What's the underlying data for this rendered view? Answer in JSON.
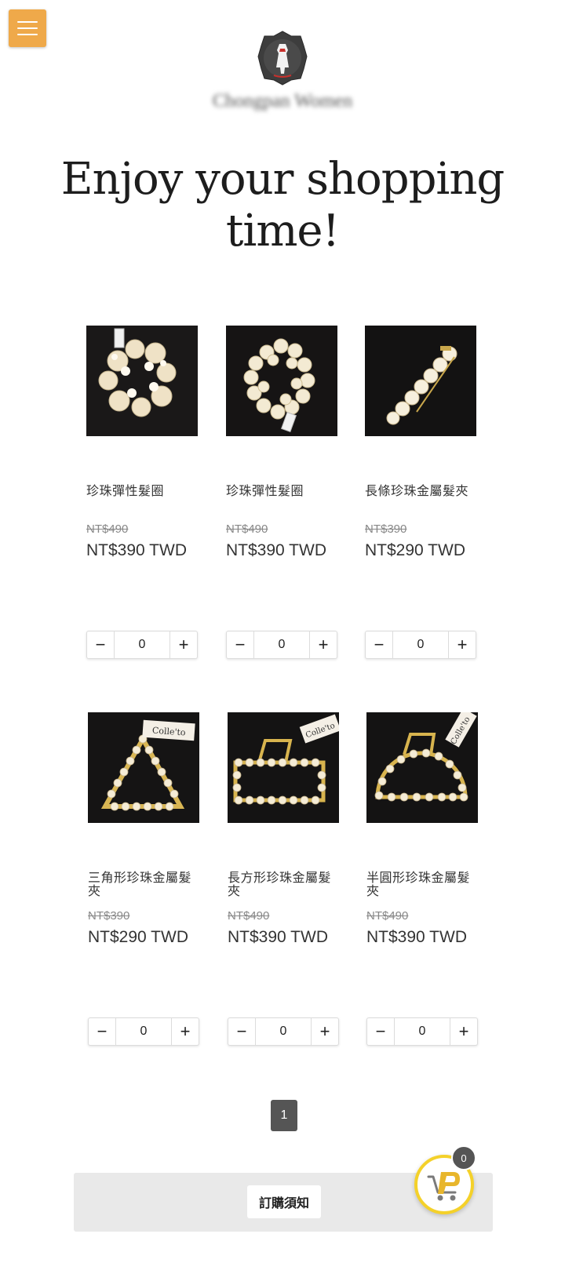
{
  "header": {
    "brand_name": "Chongpan Women",
    "headline_line1": "Enjoy your shopping",
    "headline_line2": "time!",
    "menu_icon": "hamburger-icon",
    "accent_color": "#efa94a"
  },
  "products": [
    {
      "name": "珍珠彈性髮圈",
      "original_price": "NT$490",
      "price": "NT$390 TWD",
      "quantity": "0",
      "image": "pearl-flower-scrunchie"
    },
    {
      "name": "珍珠彈性髮圈",
      "original_price": "NT$490",
      "price": "NT$390 TWD",
      "quantity": "0",
      "image": "pearl-cluster-scrunchie"
    },
    {
      "name": "長條珍珠金屬髮夾",
      "original_price": "NT$390",
      "price": "NT$290 TWD",
      "quantity": "0",
      "image": "pearl-bar-clip"
    },
    {
      "name": "三角形珍珠金屬髮夾",
      "original_price": "NT$390",
      "price": "NT$290 TWD",
      "quantity": "0",
      "image": "triangle-pearl-claw",
      "tag": "Colle'to"
    },
    {
      "name": "長方形珍珠金屬髮夾",
      "original_price": "NT$490",
      "price": "NT$390 TWD",
      "quantity": "0",
      "image": "rectangle-pearl-claw",
      "tag": "Colle'to"
    },
    {
      "name": "半圓形珍珠金屬髮夾",
      "original_price": "NT$490",
      "price": "NT$390 TWD",
      "quantity": "0",
      "image": "semicircle-pearl-claw",
      "tag": "Colle'to"
    }
  ],
  "stepper": {
    "minus": "−",
    "plus": "+"
  },
  "pagination": {
    "current_page": "1"
  },
  "footer": {
    "notice_label": "訂購須知"
  },
  "cart": {
    "count": "0",
    "icon": "cart-icon",
    "ring_color": "#f4d12a"
  }
}
